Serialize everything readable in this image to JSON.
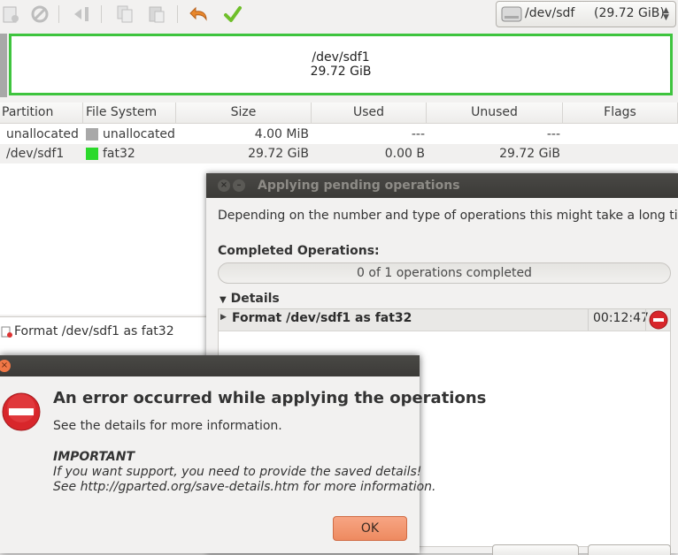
{
  "device": {
    "name": "/dev/sdf",
    "size": "(29.72 GiB)"
  },
  "graphic": {
    "partition": "/dev/sdf1",
    "size": "29.72 GiB"
  },
  "table": {
    "headers": [
      "Partition",
      "File System",
      "Size",
      "Used",
      "Unused",
      "Flags"
    ],
    "rows": [
      {
        "partition": "unallocated",
        "fs": "unallocated",
        "size": "4.00 MiB",
        "used": "---",
        "unused": "---",
        "flags": ""
      },
      {
        "partition": "/dev/sdf1",
        "fs": "fat32",
        "size": "29.72 GiB",
        "used": "0.00 B",
        "unused": "29.72 GiB",
        "flags": ""
      }
    ]
  },
  "pending": {
    "op": "Format /dev/sdf1 as fat32"
  },
  "apply_dialog": {
    "title": "Applying pending operations",
    "description": "Depending on the number and type of operations this might take a long time.",
    "completed_label": "Completed Operations:",
    "progress_text": "0 of 1 operations completed",
    "details_label": "Details",
    "operation": "Format /dev/sdf1 as fat32",
    "elapsed": "00:12:47"
  },
  "error_dialog": {
    "heading": "An error occurred while applying the operations",
    "subtext": "See the details for more information.",
    "important_label": "IMPORTANT",
    "support_line1": "If you want support, you need to provide the saved details!",
    "support_line2": "See http://gparted.org/save-details.htm for more information.",
    "ok_label": "OK"
  },
  "colors": {
    "fat32": "#2bd92b",
    "unallocated": "#a8a8a8",
    "accent": "#ee8a60",
    "error": "#d8262b"
  }
}
